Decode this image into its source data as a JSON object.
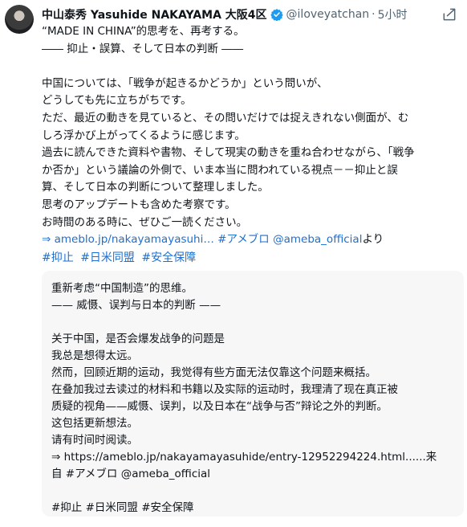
{
  "post": {
    "author_name": "中山泰秀 Yasuhide NAKAYAMA 大阪4区",
    "handle": "@iloveyatchan",
    "separator": "·",
    "time": "5小时",
    "lines": [
      "“MADE IN CHINA”的思考を、再考する。",
      "―― 抑止・誤算、そして日本の判断 ――",
      "",
      "中国については、「戦争が起きるかどうか」という問いが、",
      "どうしても先に立ちがちです。",
      "ただ、最近の動きを見ていると、その問いだけでは捉えきれない側面が、む",
      "しろ浮かび上がってくるように感じます。",
      "過去に読んできた資料や書物、そして現実の動きを重ね合わせながら、「戦争",
      "か否か」という議論の外側で、いま本当に問われている視点－－抑止と誤",
      "算、そして日本の判断について整理しました。",
      "思考のアップデートも含めた考察です。",
      "お時間のある時に、ぜひご一読ください。"
    ],
    "link_prefix": "⇒ ",
    "link_url": "ameblo.jp/nakayamayasuhi…",
    "link_tag": "#アメブロ",
    "link_mention": "@ameba_official",
    "link_suffix": "より",
    "hashtags": [
      "#抑止",
      "#日米同盟",
      "#安全保障"
    ]
  },
  "translation": {
    "lines": [
      "重新考虑“中国制造”的思维。",
      "—— 威慑、误判与日本的判断 ——",
      "",
      "关于中国，是否会爆发战争的问题是",
      "我总是想得太远。",
      "然而，回顾近期的运动，我觉得有些方面无法仅靠这个问题来概括。",
      "在叠加我过去读过的材料和书籍以及实际的运动时，我理清了现在真正被",
      "质疑的视角——威慑、误判，以及日本在“战争与否”辩论之外的判断。",
      "这包括更新想法。",
      "请有时间时阅读。",
      "⇒ https://ameblo.jp/nakayamayasuhide/entry-12952294224.html......来",
      "自 #アメブロ @ameba_official",
      "",
      "#抑止 #日米同盟 #安全保障"
    ]
  },
  "icons": {
    "verified": "verified-badge-icon",
    "share": "share-icon"
  },
  "colors": {
    "link": "#1d6fd1",
    "verified": "#1d9bf0",
    "muted": "#536471"
  }
}
